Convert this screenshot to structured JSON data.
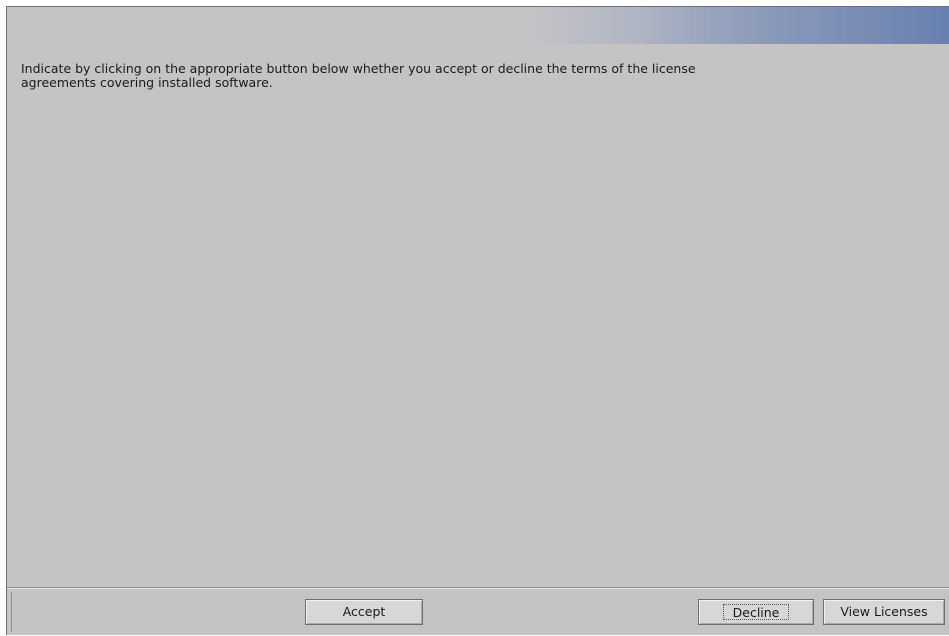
{
  "message": {
    "text": "Indicate by clicking on the appropriate button below whether you  accept or decline the terms of the license\nagreements covering installed software."
  },
  "buttons": {
    "accept_label": "Accept",
    "decline_label": "Decline",
    "view_licenses_label": "View Licenses"
  },
  "colors": {
    "panel_background": "#c5c3c6",
    "banner_accent": "#6880b0"
  }
}
